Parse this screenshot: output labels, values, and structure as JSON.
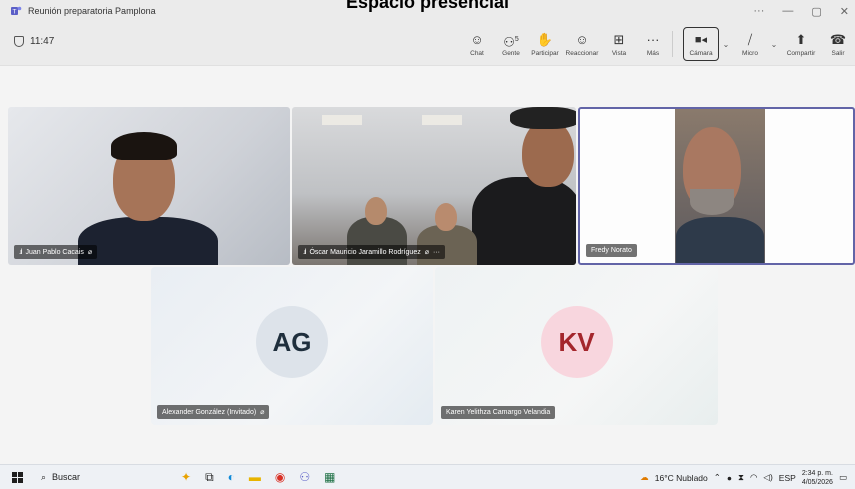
{
  "overlay": {
    "heading": "Espacio presencial"
  },
  "window": {
    "title": "Reunión preparatoria Pamplona"
  },
  "toolbar": {
    "timer": "11:47",
    "items": {
      "chat": "Chat",
      "people": "Gente",
      "people_count": "5",
      "raise": "Participar",
      "react": "Reaccionar",
      "view": "Vista",
      "more": "Más",
      "camera": "Cámara",
      "mic": "Micro",
      "share": "Compartir",
      "leave": "Salir"
    }
  },
  "participants": [
    {
      "name": "Juan Pablo Cacais"
    },
    {
      "name": "Óscar Mauricio Jaramillo Rodríguez"
    },
    {
      "name": "Fredy Norato"
    },
    {
      "name": "Alexander González (Invitado)",
      "initials": "AG"
    },
    {
      "name": "Karen Yelithza Camargo Velandia",
      "initials": "KV"
    }
  ],
  "taskbar": {
    "search": "Buscar",
    "weather": "16°C Nublado",
    "lang": "ESP",
    "time": "2:34 p. m.",
    "date": "4/05/2026"
  },
  "colors": {
    "accent": "#6264a7",
    "leave": "#c4314b",
    "avatar_kv_text": "#a4262c"
  }
}
